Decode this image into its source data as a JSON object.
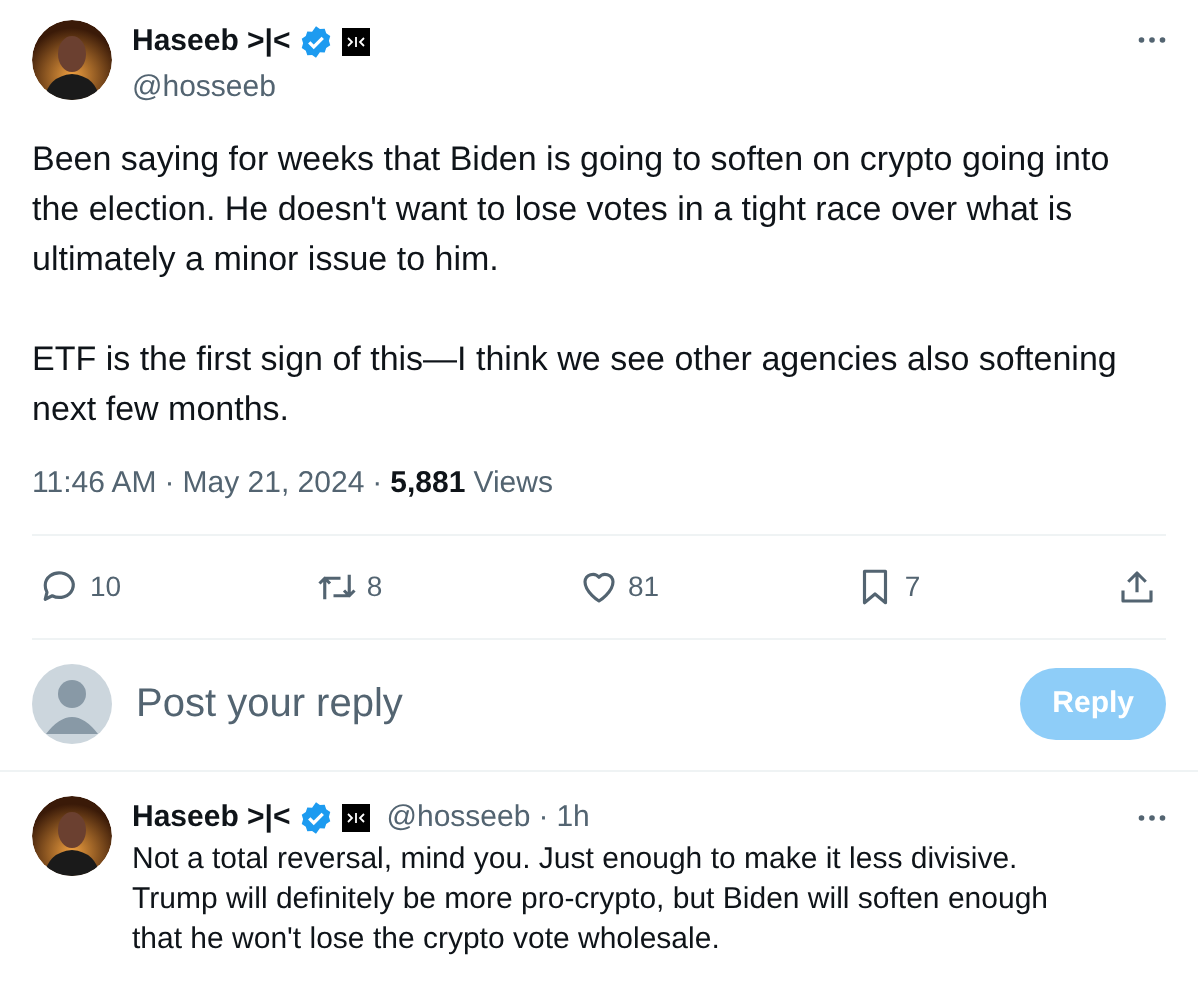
{
  "tweet": {
    "name": "Haseeb >|<",
    "verified": true,
    "handle": "@hosseeb",
    "paragraphs": [
      "Been saying for weeks that Biden is going to soften on crypto going into the election. He doesn't want to lose votes in a tight race over what is ultimately a minor issue to him.",
      "ETF is the first sign of this—I think we see other agencies also softening next few months."
    ],
    "time": "11:46 AM",
    "date": "May 21, 2024",
    "views_count": "5,881",
    "views_label": "Views",
    "separator": "·",
    "actions": [
      {
        "kind": "reply",
        "count": "10"
      },
      {
        "kind": "repost",
        "count": "8"
      },
      {
        "kind": "like",
        "count": "81"
      },
      {
        "kind": "bookmark",
        "count": "7"
      },
      {
        "kind": "share"
      }
    ]
  },
  "composer": {
    "placeholder": "Post your reply",
    "button": "Reply"
  },
  "reply": {
    "name": "Haseeb >|<",
    "verified": true,
    "handle": "@hosseeb",
    "separator": "·",
    "age": "1h",
    "text": "Not a total reversal, mind you. Just enough to make it less divisive. Trump will definitely be more pro-crypto, but Biden will soften enough that he won't lose the crypto vote wholesale."
  }
}
